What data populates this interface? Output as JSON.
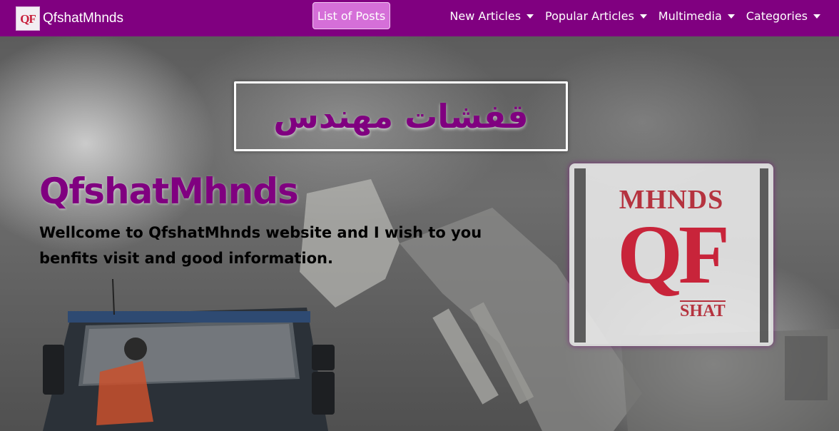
{
  "navbar": {
    "brand_name": "QfshatMhnds",
    "brand_logo_text": "QF",
    "posts_button": "List of Posts",
    "items": [
      {
        "label": "New Articles"
      },
      {
        "label": "Popular Articles"
      },
      {
        "label": "Multimedia"
      },
      {
        "label": "Categories"
      }
    ],
    "background": "#800080"
  },
  "hero": {
    "arabic_title": "قفشات مهندس",
    "site_name": "QfshatMhnds",
    "welcome_text": "Wellcome to QfshatMhnds website and I wish to you benfits visit and good information.",
    "logo": {
      "top_text": "MHNDS",
      "main_text": "QF",
      "bottom_text": "SHAT"
    },
    "accent_color": "#800080",
    "logo_color": "#c8243a"
  }
}
